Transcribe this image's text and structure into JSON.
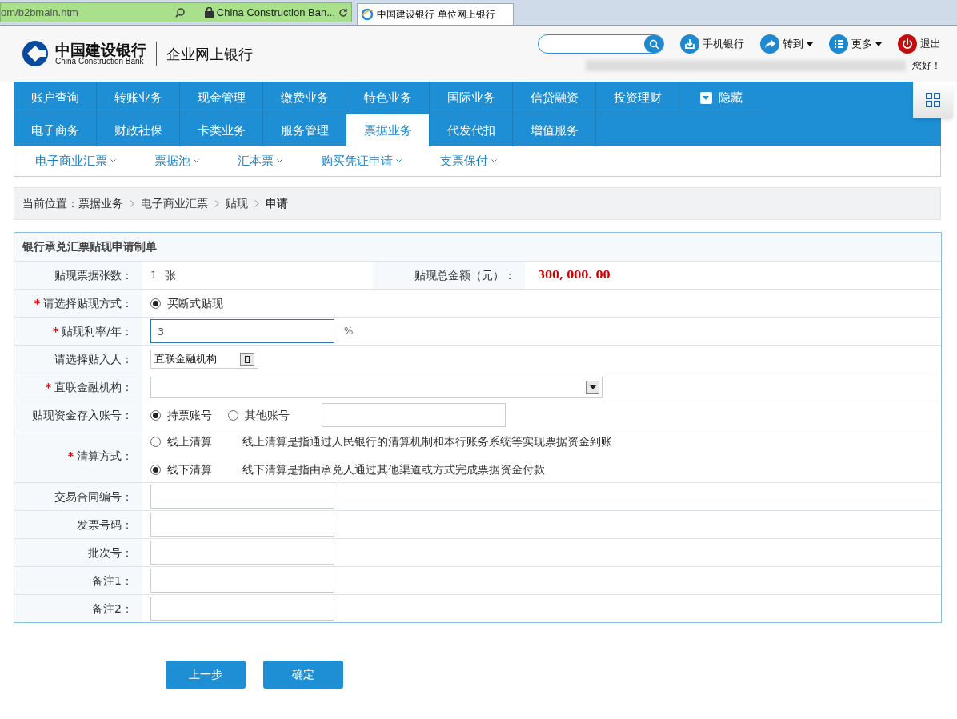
{
  "browser": {
    "address": "om/b2bmain.htm",
    "site": "China Construction Ban...",
    "tab": "中国建设银行 单位网上银行"
  },
  "header": {
    "bank_name": "中国建设银行",
    "bank_name_en": "China Construction Bank",
    "product": "企业网上银行",
    "greeting": "您好！",
    "actions": [
      {
        "kind": "mobile",
        "label": "手机银行",
        "dropdown": false
      },
      {
        "kind": "goto",
        "label": "转到",
        "dropdown": true
      },
      {
        "kind": "more",
        "label": "更多",
        "dropdown": true
      },
      {
        "kind": "logout",
        "label": "退出",
        "dropdown": false
      }
    ]
  },
  "nav": {
    "rows": [
      [
        {
          "label": "账户查询",
          "selected": false
        },
        {
          "label": "转账业务",
          "selected": false
        },
        {
          "label": "现金管理",
          "selected": false
        },
        {
          "label": "缴费业务",
          "selected": false
        },
        {
          "label": "特色业务",
          "selected": false
        },
        {
          "label": "国际业务",
          "selected": false
        },
        {
          "label": "信贷融资",
          "selected": false
        },
        {
          "label": "投资理财",
          "selected": false
        }
      ],
      [
        {
          "label": "电子商务",
          "selected": false
        },
        {
          "label": "财政社保",
          "selected": false
        },
        {
          "label": "卡类业务",
          "selected": false
        },
        {
          "label": "服务管理",
          "selected": false
        },
        {
          "label": "票据业务",
          "selected": true
        },
        {
          "label": "代发代扣",
          "selected": false
        },
        {
          "label": "增值服务",
          "selected": false
        }
      ]
    ],
    "hide_label": "隐藏"
  },
  "subnav": [
    "电子商业汇票",
    "票据池",
    "汇本票",
    "购买凭证申请",
    "支票保付"
  ],
  "breadcrumb": {
    "prefix": "当前位置：",
    "items": [
      "票据业务",
      "电子商业汇票",
      "贴现",
      "申请"
    ]
  },
  "form": {
    "title": "银行承兑汇票贴现申请制单",
    "rows": [
      {
        "kind": "summary",
        "label": "贴现票据张数：",
        "value": "1",
        "unit": "张",
        "label2": "贴现总金额（元）：",
        "value2": "300, 000. 00"
      },
      {
        "kind": "radios",
        "label": "请选择贴现方式：",
        "marker": "*",
        "options": [
          {
            "label": "买断式贴现",
            "selected": true
          }
        ]
      },
      {
        "kind": "input",
        "label": "贴现利率/年：",
        "marker": "*",
        "value": "3",
        "suffix": "%",
        "focused": true
      },
      {
        "kind": "picker",
        "label": "请选择贴入人：",
        "value": "直联金融机构"
      },
      {
        "kind": "select",
        "label": "直联金融机构：",
        "marker": "*"
      },
      {
        "kind": "radios_field",
        "label": "贴现资金存入账号：",
        "options": [
          {
            "label": "持票账号",
            "selected": true
          },
          {
            "label": "其他账号",
            "selected": false
          }
        ]
      },
      {
        "kind": "settlement",
        "label": "清算方式：",
        "marker": "*",
        "options": [
          {
            "label": "线上清算",
            "description": "线上清算是指通过人民银行的清算机制和本行账务系统等实现票据资金到账",
            "selected": false
          },
          {
            "label": "线下清算",
            "description": "线下清算是指由承兑人通过其他渠道或方式完成票据资金付款",
            "selected": true
          }
        ]
      },
      {
        "kind": "input",
        "label": "交易合同编号：",
        "focused": false
      },
      {
        "kind": "input",
        "label": "发票号码：",
        "focused": false
      },
      {
        "kind": "input",
        "label": "批次号：",
        "focused": false
      },
      {
        "kind": "input",
        "label": "备注1：",
        "focused": false
      },
      {
        "kind": "input",
        "label": "备注2：",
        "focused": false
      }
    ]
  },
  "buttons": [
    "上一步",
    "确定"
  ]
}
